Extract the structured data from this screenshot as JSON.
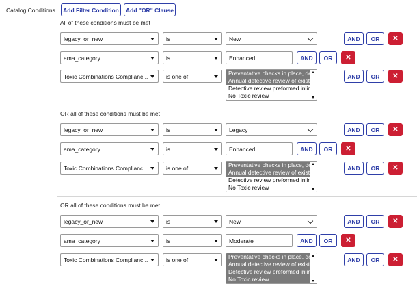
{
  "section_label": "Catalog Conditions",
  "toolbar": {
    "add_filter_label": "Add Filter Condition",
    "add_or_label": "Add \"OR\" Clause"
  },
  "buttons": {
    "and": "AND",
    "or": "OR",
    "remove_symbol": "✕"
  },
  "groups": [
    {
      "heading": "All of these conditions must be met",
      "rows": [
        {
          "field": "legacy_or_new",
          "operator": "is",
          "value": "New"
        },
        {
          "field": "ama_category",
          "operator": "is",
          "value": "Enhanced"
        },
        {
          "field": "Toxic Combinations Complianc...",
          "operator": "is one of",
          "options": [
            {
              "text": "Preventative checks in place, detect",
              "selected": true
            },
            {
              "text": "Annual detective review of existing",
              "selected": true
            },
            {
              "text": "Detective review preformed inline",
              "selected": false
            },
            {
              "text": "No Toxic review",
              "selected": false
            }
          ]
        }
      ]
    },
    {
      "heading": "OR all of these conditions must be met",
      "rows": [
        {
          "field": "legacy_or_new",
          "operator": "is",
          "value": "Legacy"
        },
        {
          "field": "ama_category",
          "operator": "is",
          "value": "Enhanced"
        },
        {
          "field": "Toxic Combinations Complianc...",
          "operator": "is one of",
          "options": [
            {
              "text": "Preventative checks in place, detect",
              "selected": true
            },
            {
              "text": "Annual detective review of existing",
              "selected": true
            },
            {
              "text": "Detective review preformed inline",
              "selected": false
            },
            {
              "text": "No Toxic review",
              "selected": false
            }
          ]
        }
      ]
    },
    {
      "heading": "OR all of these conditions must be met",
      "rows": [
        {
          "field": "legacy_or_new",
          "operator": "is",
          "value": "New"
        },
        {
          "field": "ama_category",
          "operator": "is",
          "value": "Moderate"
        },
        {
          "field": "Toxic Combinations Complianc...",
          "operator": "is one of",
          "options": [
            {
              "text": "Preventative checks in place, detect",
              "selected": true
            },
            {
              "text": "Annual detective review of existing",
              "selected": true
            },
            {
              "text": "Detective review preformed inline",
              "selected": true
            },
            {
              "text": "No Toxic review",
              "selected": true
            }
          ]
        }
      ]
    }
  ]
}
